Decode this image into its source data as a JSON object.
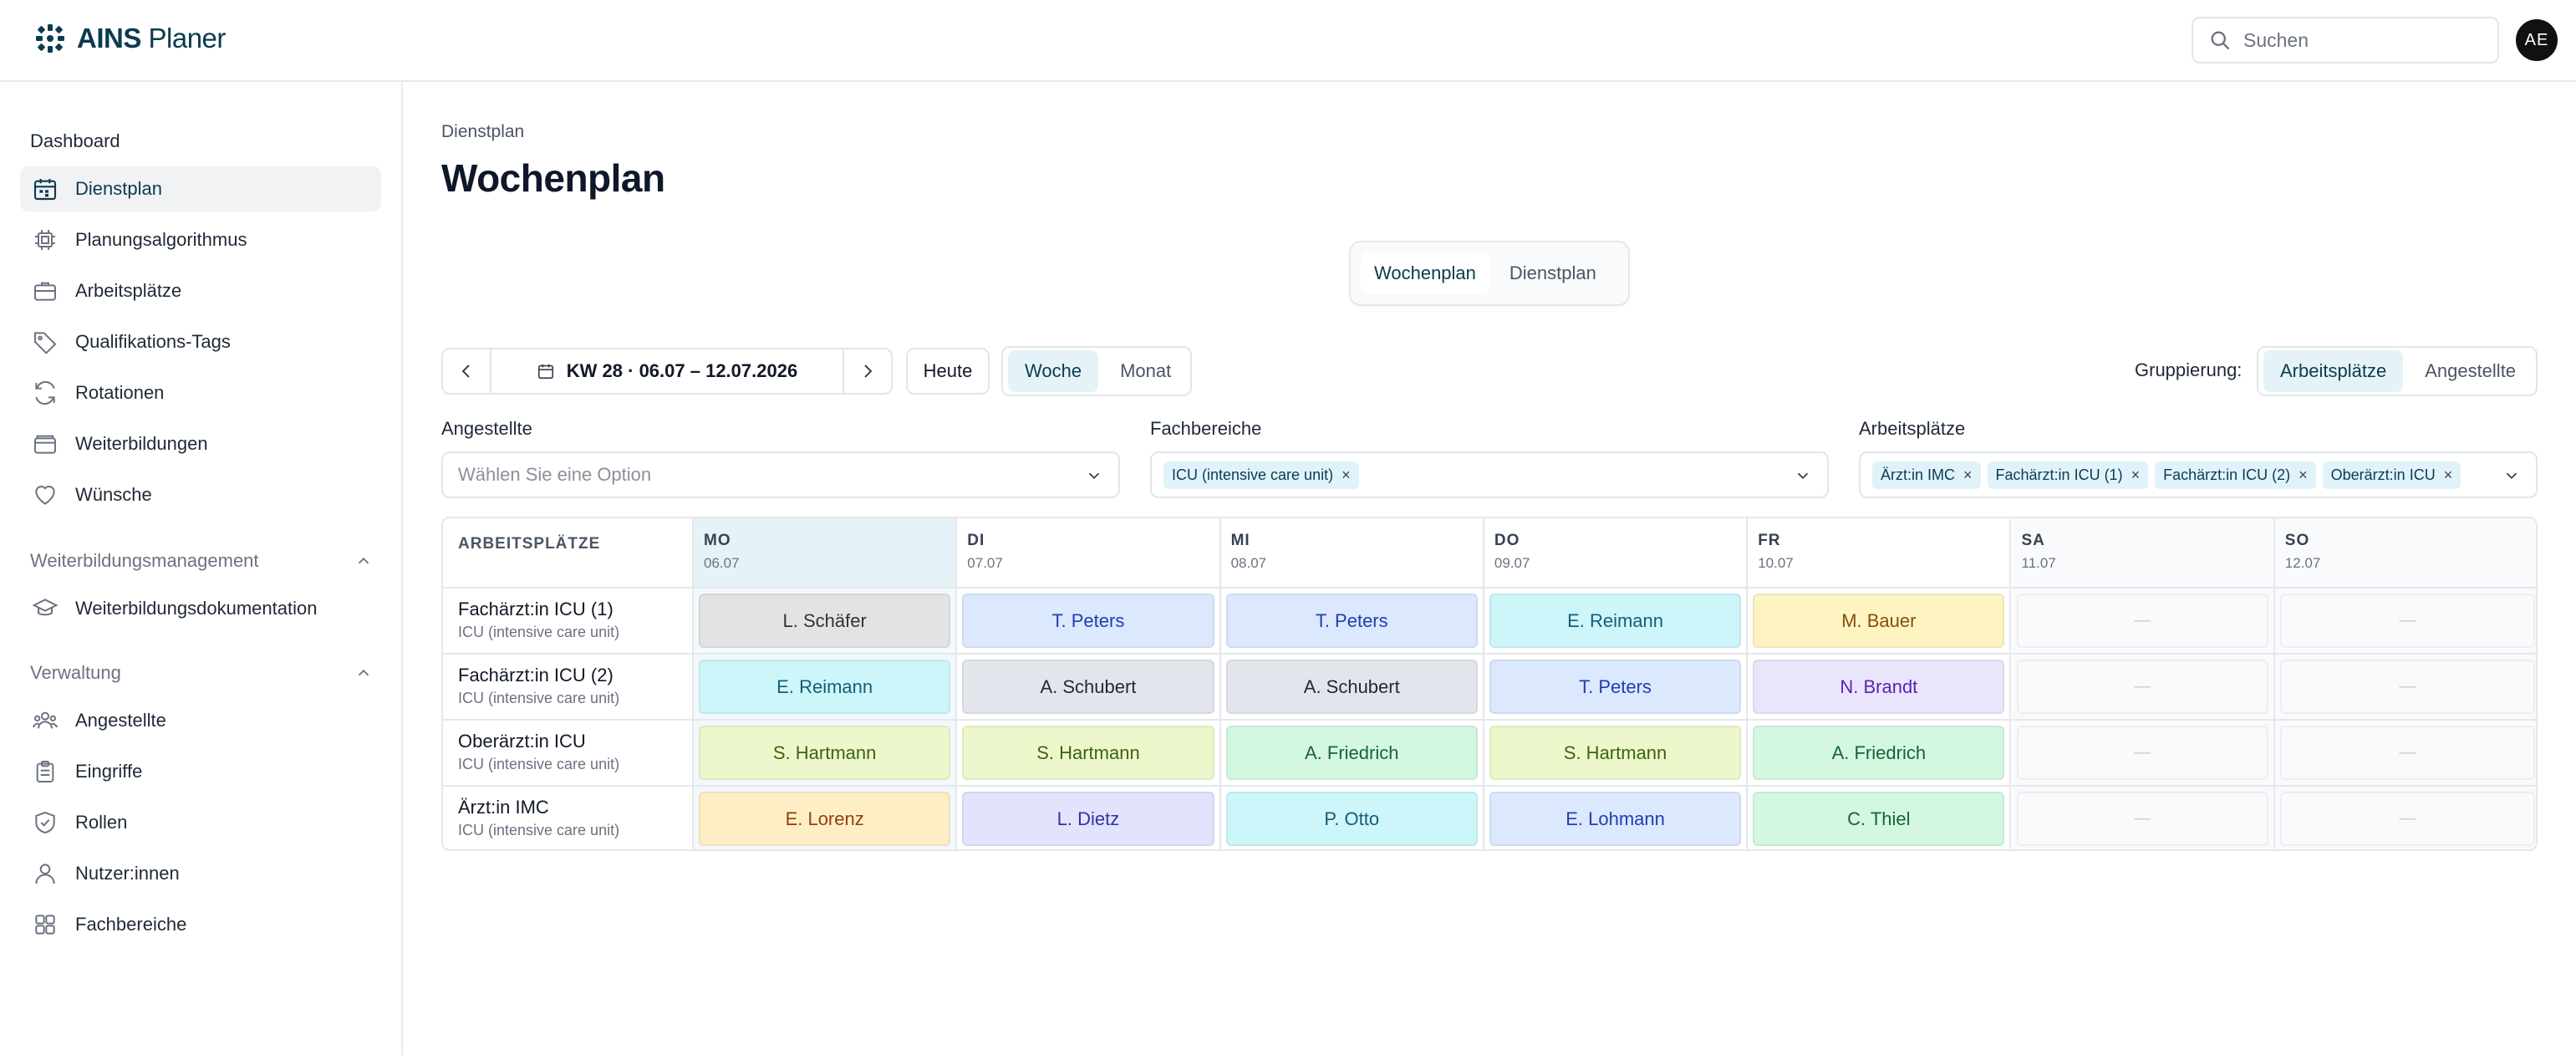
{
  "header": {
    "brand_bold": "AINS",
    "brand_rest": " Planer",
    "search_placeholder": "Suchen",
    "avatar_initials": "AE"
  },
  "sidebar": {
    "dashboard_label": "Dashboard",
    "items": [
      {
        "label": "Dienstplan",
        "icon": "calendar-icon",
        "active": true
      },
      {
        "label": "Planungsalgorithmus",
        "icon": "chip-icon"
      },
      {
        "label": "Arbeitsplätze",
        "icon": "briefcase-icon"
      },
      {
        "label": "Qualifikations-Tags",
        "icon": "tag-icon"
      },
      {
        "label": "Rotationen",
        "icon": "refresh-icon"
      },
      {
        "label": "Weiterbildungen",
        "icon": "wallet-icon"
      },
      {
        "label": "Wünsche",
        "icon": "heart-icon"
      }
    ],
    "section_training": {
      "title": "Weiterbildungsmanagement",
      "items": [
        {
          "label": "Weiterbildungsdokumentation",
          "icon": "graduation-cap-icon"
        }
      ]
    },
    "section_admin": {
      "title": "Verwaltung",
      "items": [
        {
          "label": "Angestellte",
          "icon": "users-icon"
        },
        {
          "label": "Eingriffe",
          "icon": "clipboard-icon"
        },
        {
          "label": "Rollen",
          "icon": "shield-check-icon"
        },
        {
          "label": "Nutzer:innen",
          "icon": "user-icon"
        },
        {
          "label": "Fachbereiche",
          "icon": "grid-icon"
        }
      ]
    }
  },
  "main": {
    "breadcrumb": "Dienstplan",
    "title": "Wochenplan",
    "view_tabs": [
      {
        "label": "Wochenplan",
        "active": true
      },
      {
        "label": "Dienstplan",
        "active": false
      }
    ],
    "date_range": "KW 28 · 06.07 – 12.07.2026",
    "today_button": "Heute",
    "range_options": [
      {
        "label": "Woche",
        "active": true
      },
      {
        "label": "Monat",
        "active": false
      }
    ],
    "grouping_label": "Gruppierung:",
    "grouping_options": [
      {
        "label": "Arbeitsplätze",
        "active": true
      },
      {
        "label": "Angestellte",
        "active": false
      }
    ]
  },
  "filters": {
    "employees": {
      "label": "Angestellte",
      "placeholder": "Wählen Sie eine Option"
    },
    "departments": {
      "label": "Fachbereiche",
      "chips": [
        "ICU (intensive care unit)"
      ]
    },
    "workplaces": {
      "label": "Arbeitsplätze",
      "chips": [
        "Ärzt:in IMC",
        "Fachärzt:in ICU (1)",
        "Fachärzt:in ICU (2)",
        "Oberärzt:in ICU"
      ]
    }
  },
  "schedule": {
    "first_header": "ARBEITSPLÄTZE",
    "empty_symbol": "—",
    "days": [
      {
        "name": "MO",
        "date": "06.07",
        "today": true,
        "weekend": false
      },
      {
        "name": "DI",
        "date": "07.07",
        "today": false,
        "weekend": false
      },
      {
        "name": "MI",
        "date": "08.07",
        "today": false,
        "weekend": false
      },
      {
        "name": "DO",
        "date": "09.07",
        "today": false,
        "weekend": false
      },
      {
        "name": "FR",
        "date": "10.07",
        "today": false,
        "weekend": false
      },
      {
        "name": "SA",
        "date": "11.07",
        "today": false,
        "weekend": true
      },
      {
        "name": "SO",
        "date": "12.07",
        "today": false,
        "weekend": true
      }
    ],
    "rows": [
      {
        "title": "Fachärzt:in ICU (1)",
        "subtitle": "ICU (intensive care unit)",
        "shifts": [
          {
            "name": "L. Schäfer",
            "bg": "#e3e3e3",
            "fg": "#333333"
          },
          {
            "name": "T. Peters",
            "bg": "#dbe8fd",
            "fg": "#1e40af"
          },
          {
            "name": "T. Peters",
            "bg": "#dbe8fd",
            "fg": "#1e40af"
          },
          {
            "name": "E. Reimann",
            "bg": "#cdf6fb",
            "fg": "#155e75"
          },
          {
            "name": "M. Bauer",
            "bg": "#fdf4c2",
            "fg": "#854d0e"
          },
          null,
          null
        ]
      },
      {
        "title": "Fachärzt:in ICU (2)",
        "subtitle": "ICU (intensive care unit)",
        "shifts": [
          {
            "name": "E. Reimann",
            "bg": "#cdf6fb",
            "fg": "#155e75"
          },
          {
            "name": "A. Schubert",
            "bg": "#e2e6ec",
            "fg": "#1f2937"
          },
          {
            "name": "A. Schubert",
            "bg": "#e2e6ec",
            "fg": "#1f2937"
          },
          {
            "name": "T. Peters",
            "bg": "#dbe8fd",
            "fg": "#1e40af"
          },
          {
            "name": "N. Brandt",
            "bg": "#ebe5fc",
            "fg": "#5b21b6"
          },
          null,
          null
        ]
      },
      {
        "title": "Oberärzt:in ICU",
        "subtitle": "ICU (intensive care unit)",
        "shifts": [
          {
            "name": "S. Hartmann",
            "bg": "#ecf8cb",
            "fg": "#3f6212"
          },
          {
            "name": "S. Hartmann",
            "bg": "#ecf8cb",
            "fg": "#3f6212"
          },
          {
            "name": "A. Friedrich",
            "bg": "#d4f7e2",
            "fg": "#166534"
          },
          {
            "name": "S. Hartmann",
            "bg": "#ecf8cb",
            "fg": "#3f6212"
          },
          {
            "name": "A. Friedrich",
            "bg": "#d4f7e2",
            "fg": "#166534"
          },
          null,
          null
        ]
      },
      {
        "title": "Ärzt:in IMC",
        "subtitle": "ICU (intensive care unit)",
        "shifts": [
          {
            "name": "E. Lorenz",
            "bg": "#fdeec6",
            "fg": "#92400e"
          },
          {
            "name": "L. Dietz",
            "bg": "#e1e4fc",
            "fg": "#3730a3"
          },
          {
            "name": "P. Otto",
            "bg": "#cdf6fb",
            "fg": "#155e75"
          },
          {
            "name": "E. Lohmann",
            "bg": "#dbe8fd",
            "fg": "#1e40af"
          },
          {
            "name": "C. Thiel",
            "bg": "#d4f7e2",
            "fg": "#166534"
          },
          null,
          null
        ]
      }
    ]
  },
  "colors": {
    "accent": "#0b3b4f",
    "accent_bg": "#e5f3f9",
    "border": "#e5e7eb"
  }
}
